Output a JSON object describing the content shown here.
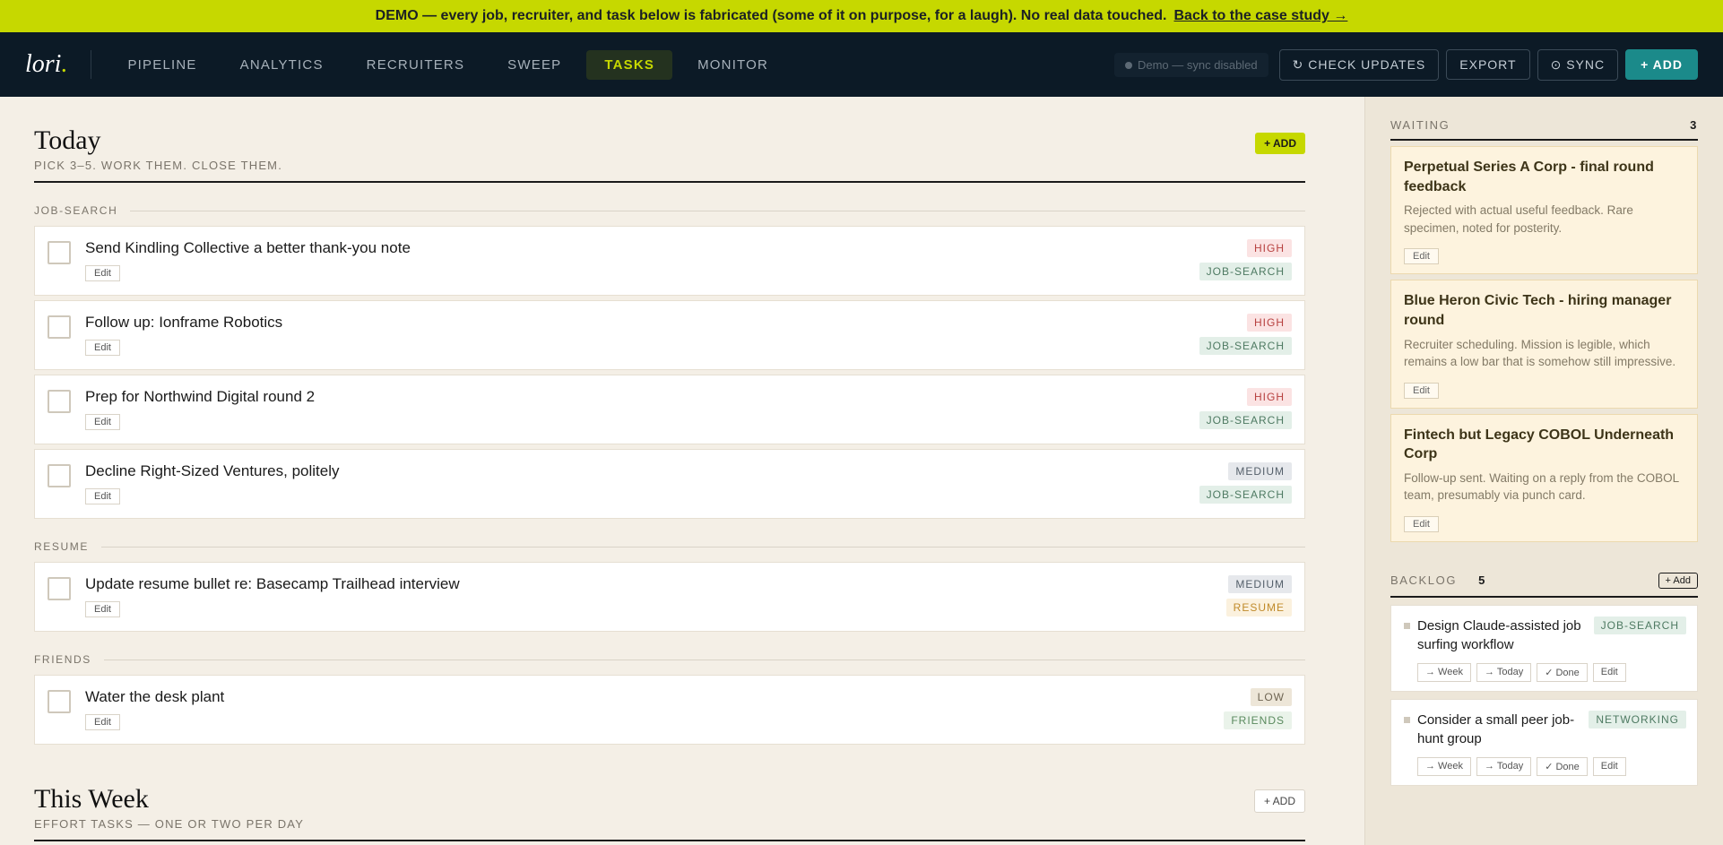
{
  "banner": {
    "text": "DEMO — every job, recruiter, and task below is fabricated (some of it on purpose, for a laugh). No real data touched.",
    "link": "Back to the case study →"
  },
  "nav": {
    "logo": "lori",
    "logo_dot": ".",
    "links": [
      "PIPELINE",
      "ANALYTICS",
      "RECRUITERS",
      "SWEEP",
      "TASKS",
      "MONITOR"
    ],
    "active": "TASKS",
    "sync_status": "Demo — sync disabled",
    "check_updates": "↻ CHECK UPDATES",
    "export": "EXPORT",
    "sync": "⊙ SYNC",
    "add": "+ ADD"
  },
  "today": {
    "title": "Today",
    "subtitle": "PICK 3–5. WORK THEM. CLOSE THEM.",
    "add": "+ ADD",
    "groups": [
      {
        "label": "JOB-SEARCH",
        "tasks": [
          {
            "title": "Send Kindling Collective a better thank-you note",
            "priority": "HIGH",
            "category": "JOB-SEARCH",
            "edit": "Edit"
          },
          {
            "title": "Follow up: Ionframe Robotics",
            "priority": "HIGH",
            "category": "JOB-SEARCH",
            "edit": "Edit"
          },
          {
            "title": "Prep for Northwind Digital round 2",
            "priority": "HIGH",
            "category": "JOB-SEARCH",
            "edit": "Edit"
          },
          {
            "title": "Decline Right-Sized Ventures, politely",
            "priority": "MEDIUM",
            "category": "JOB-SEARCH",
            "edit": "Edit"
          }
        ]
      },
      {
        "label": "RESUME",
        "tasks": [
          {
            "title": "Update resume bullet re: Basecamp Trailhead interview",
            "priority": "MEDIUM",
            "category": "RESUME",
            "edit": "Edit"
          }
        ]
      },
      {
        "label": "FRIENDS",
        "tasks": [
          {
            "title": "Water the desk plant",
            "priority": "LOW",
            "category": "FRIENDS",
            "edit": "Edit"
          }
        ]
      }
    ]
  },
  "week": {
    "title": "This Week",
    "subtitle": "EFFORT TASKS — ONE OR TWO PER DAY",
    "add": "+ ADD"
  },
  "waiting": {
    "label": "WAITING",
    "count": "3",
    "items": [
      {
        "title": "Perpetual Series A Corp - final round feedback",
        "desc": "Rejected with actual useful feedback. Rare specimen, noted for posterity.",
        "edit": "Edit"
      },
      {
        "title": "Blue Heron Civic Tech - hiring manager round",
        "desc": "Recruiter scheduling. Mission is legible, which remains a low bar that is somehow still impressive.",
        "edit": "Edit"
      },
      {
        "title": "Fintech but Legacy COBOL Underneath Corp",
        "desc": "Follow-up sent. Waiting on a reply from the COBOL team, presumably via punch card.",
        "edit": "Edit"
      }
    ]
  },
  "backlog": {
    "label": "BACKLOG",
    "count": "5",
    "add": "+ Add",
    "items": [
      {
        "title": "Design Claude-assisted job surfing workflow",
        "tag": "JOB-SEARCH",
        "week": "→ Week",
        "today": "→ Today",
        "done": "✓ Done",
        "edit": "Edit"
      },
      {
        "title": "Consider a small peer job-hunt group",
        "tag": "NETWORKING",
        "week": "→ Week",
        "today": "→ Today",
        "done": "✓ Done",
        "edit": "Edit"
      }
    ]
  }
}
